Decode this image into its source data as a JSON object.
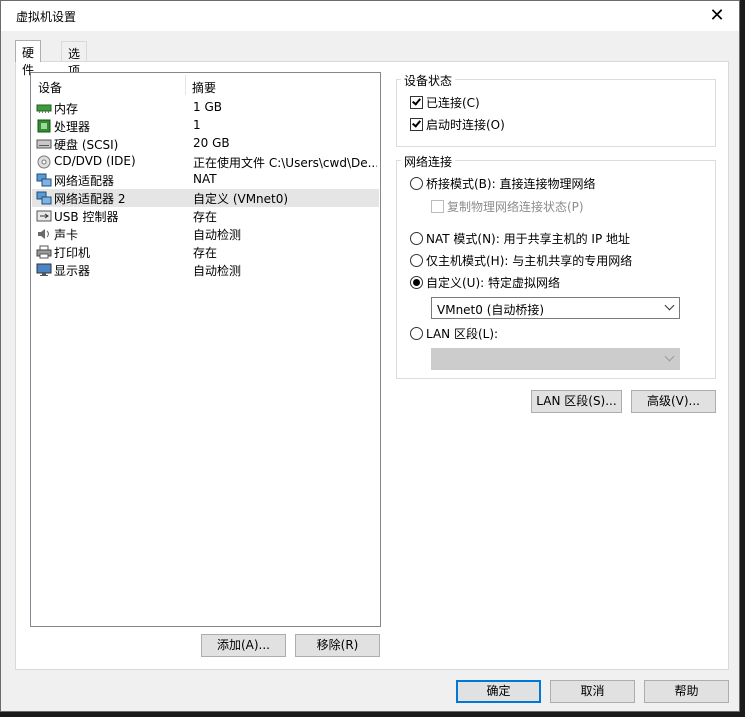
{
  "window": {
    "title": "虚拟机设置",
    "close_glyph": "✕"
  },
  "tabs": [
    {
      "label": "硬件",
      "active": true
    },
    {
      "label": "选项",
      "active": false
    }
  ],
  "device_list": {
    "columns": {
      "device": "设备",
      "summary": "摘要"
    },
    "rows": [
      {
        "icon": "memory-icon",
        "name": "内存",
        "summary": "1 GB"
      },
      {
        "icon": "processor-icon",
        "name": "处理器",
        "summary": "1"
      },
      {
        "icon": "hard-disk-icon",
        "name": "硬盘 (SCSI)",
        "summary": "20 GB"
      },
      {
        "icon": "cd-dvd-icon",
        "name": "CD/DVD (IDE)",
        "summary": "正在使用文件 C:\\Users\\cwd\\De..."
      },
      {
        "icon": "network-adapter-icon",
        "name": "网络适配器",
        "summary": "NAT"
      },
      {
        "icon": "network-adapter-icon",
        "name": "网络适配器 2",
        "summary": "自定义 (VMnet0)",
        "selected": true
      },
      {
        "icon": "usb-icon",
        "name": "USB 控制器",
        "summary": "存在"
      },
      {
        "icon": "sound-card-icon",
        "name": "声卡",
        "summary": "自动检测"
      },
      {
        "icon": "printer-icon",
        "name": "打印机",
        "summary": "存在"
      },
      {
        "icon": "display-icon",
        "name": "显示器",
        "summary": "自动检测"
      }
    ],
    "add_button": "添加(A)...",
    "remove_button": "移除(R)"
  },
  "device_status": {
    "label": "设备状态",
    "connected": {
      "label": "已连接(C)",
      "checked": true
    },
    "connect_at_power_on": {
      "label": "启动时连接(O)",
      "checked": true
    }
  },
  "network": {
    "label": "网络连接",
    "bridged": {
      "label": "桥接模式(B): 直接连接物理网络",
      "selected": false
    },
    "replicate": {
      "label": "复制物理网络连接状态(P)",
      "checked": false,
      "disabled": true
    },
    "nat": {
      "label": "NAT 模式(N): 用于共享主机的 IP 地址",
      "selected": false
    },
    "host_only": {
      "label": "仅主机模式(H): 与主机共享的专用网络",
      "selected": false
    },
    "custom": {
      "label": "自定义(U): 特定虚拟网络",
      "selected": true
    },
    "custom_value": "VMnet0 (自动桥接)",
    "lan_segment": {
      "label": "LAN 区段(L):",
      "selected": false
    },
    "lan_value": ""
  },
  "buttons": {
    "lan_segments": "LAN 区段(S)...",
    "advanced": "高级(V)...",
    "ok": "确定",
    "cancel": "取消",
    "help": "帮助"
  },
  "colors": {
    "selection": "#e5e5e5",
    "default_button_border": "#0078d7"
  }
}
